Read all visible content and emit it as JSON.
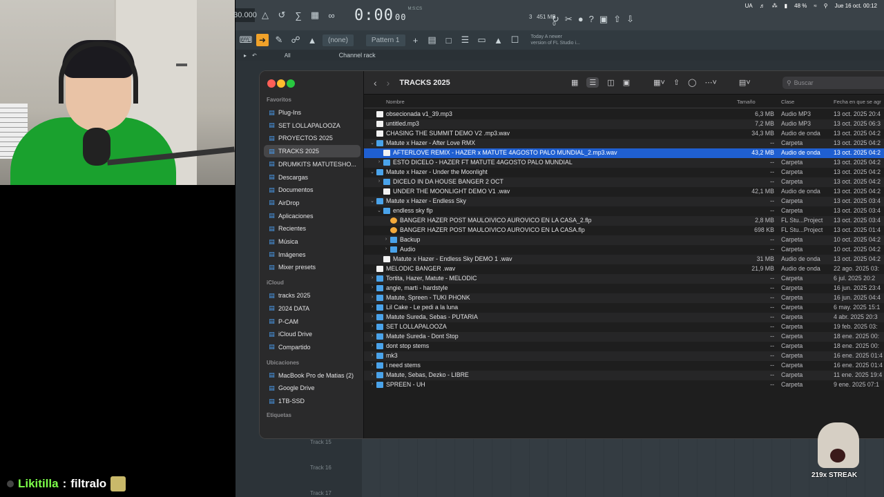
{
  "fl": {
    "tempo": "30.000",
    "time": "0:00",
    "time_unit": "00",
    "time_sub_label": "M:S:CS",
    "cpu_num": "3",
    "mem": "451 MB",
    "mem_sub": "0",
    "pattern_none": "(none)",
    "pattern": "Pattern 1",
    "news_line1": "Today  A newer",
    "news_line2": "version of FL Studio i...",
    "filter_all": "All",
    "channel_rack": "Channel rack",
    "tracks": [
      "Track 15",
      "Track 16",
      "Track 17"
    ]
  },
  "menubar": {
    "locale": "UA",
    "battery": "48 %",
    "datetime": "Jue 16 oct.  00:12"
  },
  "finder": {
    "title": "TRACKS 2025",
    "search_placeholder": "Buscar",
    "sidebar": {
      "favorites_label": "Favoritos",
      "favorites": [
        {
          "label": "Plug-Ins",
          "icon": "folder-icon"
        },
        {
          "label": "SET LOLLAPALOOZA",
          "icon": "folder-icon"
        },
        {
          "label": "PROYECTOS 2025",
          "icon": "folder-icon"
        },
        {
          "label": "TRACKS 2025",
          "icon": "folder-icon",
          "selected": true
        },
        {
          "label": "DRUMKITS MATUTESHO...",
          "icon": "folder-icon"
        },
        {
          "label": "Descargas",
          "icon": "download-icon"
        },
        {
          "label": "Documentos",
          "icon": "document-icon"
        },
        {
          "label": "AirDrop",
          "icon": "airdrop-icon"
        },
        {
          "label": "Aplicaciones",
          "icon": "apps-icon"
        },
        {
          "label": "Recientes",
          "icon": "clock-icon"
        },
        {
          "label": "Música",
          "icon": "music-icon"
        },
        {
          "label": "Imágenes",
          "icon": "image-icon"
        },
        {
          "label": "Mixer presets",
          "icon": "folder-icon"
        }
      ],
      "icloud_label": "iCloud",
      "icloud": [
        {
          "label": "tracks 2025",
          "icon": "folder-icon"
        },
        {
          "label": "2024 DATA",
          "icon": "folder-icon"
        },
        {
          "label": "P-CAM",
          "icon": "folder-icon"
        },
        {
          "label": "iCloud Drive",
          "icon": "cloud-icon"
        },
        {
          "label": "Compartido",
          "icon": "shared-icon"
        }
      ],
      "locations_label": "Ubicaciones",
      "locations": [
        {
          "label": "MacBook Pro de Matias (2)",
          "icon": "laptop-icon"
        },
        {
          "label": "Google Drive",
          "icon": "drive-icon"
        },
        {
          "label": "1TB-SSD",
          "icon": "disk-icon"
        }
      ],
      "tags_label": "Etiquetas"
    },
    "columns": {
      "name": "Nombre",
      "size": "Tamaño",
      "kind": "Clase",
      "date": "Fecha en que se agr"
    },
    "rows": [
      {
        "name": "obsecionada v1_39.mp3",
        "size": "6,3 MB",
        "kind": "Audio MP3",
        "date": "13 oct. 2025 20:4",
        "type": "file",
        "depth": 0
      },
      {
        "name": "untitled.mp3",
        "size": "7,2 MB",
        "kind": "Audio MP3",
        "date": "13 oct. 2025 06:3",
        "type": "file",
        "depth": 0
      },
      {
        "name": "CHASING THE SUMMIT DEMO V2 .mp3.wav",
        "size": "34,3 MB",
        "kind": "Audio de onda",
        "date": "13 oct. 2025 04:2",
        "type": "file",
        "depth": 0
      },
      {
        "name": "Matute x Hazer - After Love RMX",
        "size": "--",
        "kind": "Carpeta",
        "date": "13 oct. 2025 04:2",
        "type": "folder",
        "depth": 0,
        "open": true
      },
      {
        "name": "AFTERLOVE REMIX - HAZER x MATUTE 4AGOSTO PALO MUNDIAL_2.mp3.wav",
        "size": "43,2 MB",
        "kind": "Audio de onda",
        "date": "13 oct. 2025 04:2",
        "type": "file",
        "depth": 1,
        "selected": true
      },
      {
        "name": "ESTO DICELO - HAZER FT MATUTE 4AGOSTO PALO MUNDIAL",
        "size": "--",
        "kind": "Carpeta",
        "date": "13 oct. 2025 04:2",
        "type": "folder",
        "depth": 1,
        "closed": true
      },
      {
        "name": "Matute x Hazer - Under the Moonlight",
        "size": "--",
        "kind": "Carpeta",
        "date": "13 oct. 2025 04:2",
        "type": "folder",
        "depth": 0,
        "open": true
      },
      {
        "name": "DICELO IN DA HOUSE BANGER 2 OCT",
        "size": "--",
        "kind": "Carpeta",
        "date": "13 oct. 2025 04:2",
        "type": "folder",
        "depth": 1,
        "closed": true
      },
      {
        "name": "UNDER THE MOONLIGHT DEMO V1 .wav",
        "size": "42,1 MB",
        "kind": "Audio de onda",
        "date": "13 oct. 2025 04:2",
        "type": "file",
        "depth": 1
      },
      {
        "name": "Matute x Hazer - Endless Sky",
        "size": "--",
        "kind": "Carpeta",
        "date": "13 oct. 2025 03:4",
        "type": "folder",
        "depth": 0,
        "open": true
      },
      {
        "name": "endless sky flp",
        "size": "--",
        "kind": "Carpeta",
        "date": "13 oct. 2025 03:4",
        "type": "folder",
        "depth": 1,
        "open": true
      },
      {
        "name": "BANGER HAZER  POST MAULOIVICO AUROVICO EN LA CASA_2.flp",
        "size": "2,8 MB",
        "kind": "FL Stu...Project",
        "date": "13 oct. 2025 03:4",
        "type": "flp",
        "depth": 2
      },
      {
        "name": "BANGER HAZER  POST MAULOIVICO AUROVICO EN LA CASA.flp",
        "size": "698 KB",
        "kind": "FL Stu...Project",
        "date": "13 oct. 2025 01:4",
        "type": "flp",
        "depth": 2
      },
      {
        "name": "Backup",
        "size": "--",
        "kind": "Carpeta",
        "date": "10 oct. 2025 04:2",
        "type": "folder",
        "depth": 2,
        "closed": true
      },
      {
        "name": "Audio",
        "size": "--",
        "kind": "Carpeta",
        "date": "10 oct. 2025 04:2",
        "type": "folder",
        "depth": 2,
        "closed": true
      },
      {
        "name": "Matute x Hazer - Endless Sky DEMO 1 .wav",
        "size": "31 MB",
        "kind": "Audio de onda",
        "date": "13 oct. 2025 04:2",
        "type": "file",
        "depth": 1
      },
      {
        "name": "MELODIC BANGER .wav",
        "size": "21,9 MB",
        "kind": "Audio de onda",
        "date": "22 ago. 2025 03:",
        "type": "file",
        "depth": 0
      },
      {
        "name": "Tortita, Hazer, Matute - MELODIC",
        "size": "--",
        "kind": "Carpeta",
        "date": "6 jul. 2025 20:2",
        "type": "folder",
        "depth": 0,
        "closed": true
      },
      {
        "name": "angie, marti - hardstyle",
        "size": "--",
        "kind": "Carpeta",
        "date": "16 jun. 2025 23:4",
        "type": "folder",
        "depth": 0,
        "closed": true
      },
      {
        "name": "Matute, Spreen - TUKI PHONK",
        "size": "--",
        "kind": "Carpeta",
        "date": "16 jun. 2025 04:4",
        "type": "folder",
        "depth": 0,
        "closed": true
      },
      {
        "name": "Lil Cake - Le pedi a la luna",
        "size": "--",
        "kind": "Carpeta",
        "date": "6 may. 2025 15:1",
        "type": "folder",
        "depth": 0,
        "closed": true
      },
      {
        "name": "Matute Sureda, Sebas - PUTARIA",
        "size": "--",
        "kind": "Carpeta",
        "date": "4 abr. 2025 20:3",
        "type": "folder",
        "depth": 0,
        "closed": true
      },
      {
        "name": "SET LOLLAPALOOZA",
        "size": "--",
        "kind": "Carpeta",
        "date": "19 feb. 2025 03:",
        "type": "folder",
        "depth": 0,
        "closed": true
      },
      {
        "name": "Matute Sureda - Dont Stop",
        "size": "--",
        "kind": "Carpeta",
        "date": "18 ene. 2025 00:",
        "type": "folder",
        "depth": 0,
        "closed": true
      },
      {
        "name": "dont stop stems",
        "size": "--",
        "kind": "Carpeta",
        "date": "18 ene. 2025 00:",
        "type": "folder",
        "depth": 0,
        "closed": true
      },
      {
        "name": "mk3",
        "size": "--",
        "kind": "Carpeta",
        "date": "16 ene. 2025 01:4",
        "type": "folder",
        "depth": 0,
        "closed": true
      },
      {
        "name": "i need stems",
        "size": "--",
        "kind": "Carpeta",
        "date": "16 ene. 2025 01:4",
        "type": "folder",
        "depth": 0,
        "closed": true
      },
      {
        "name": "Matute, Sebas, Dezko - LIBRE",
        "size": "--",
        "kind": "Carpeta",
        "date": "11 ene. 2025 19:4",
        "type": "folder",
        "depth": 0,
        "closed": true
      },
      {
        "name": "SPREEN - UH",
        "size": "--",
        "kind": "Carpeta",
        "date": "9 ene. 2025 07:1",
        "type": "folder",
        "depth": 0,
        "closed": true
      }
    ]
  },
  "chat": {
    "user": "Likitilla",
    "separator": ":",
    "message": "filtralo"
  },
  "streak": {
    "label": "219x STREAK"
  }
}
